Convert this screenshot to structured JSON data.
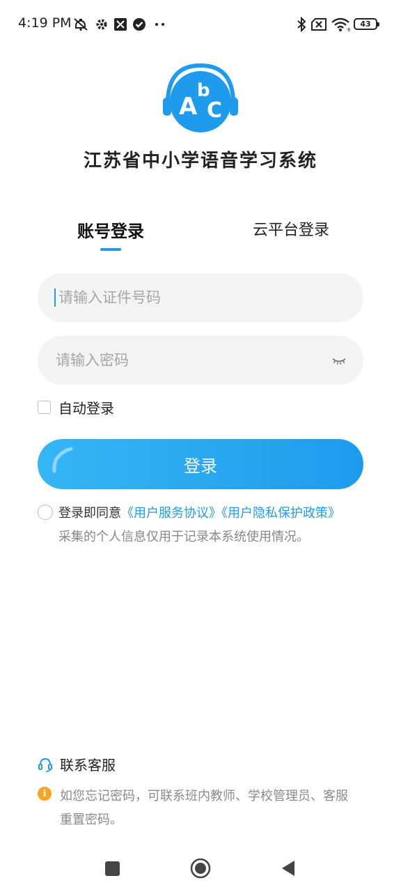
{
  "status_bar": {
    "time": "4:19 PM",
    "icons_left": [
      "mute-icon",
      "gear-icon",
      "app-icon",
      "check-circle-icon",
      "more-dots-icon"
    ],
    "icons_right": [
      "bluetooth-icon",
      "sim-off-icon",
      "wifi-icon"
    ],
    "battery": "43"
  },
  "app": {
    "title": "江苏省中小学语音学习系统",
    "logo_letters": [
      "A",
      "b",
      "C"
    ],
    "accent_color": "#1e9bec"
  },
  "tabs": [
    {
      "label": "账号登录",
      "active": true
    },
    {
      "label": "云平台登录",
      "active": false
    }
  ],
  "form": {
    "id_placeholder": "请输入证件号码",
    "id_value": "",
    "password_placeholder": "请输入密码",
    "password_value": "",
    "auto_login_label": "自动登录",
    "auto_login_checked": false,
    "login_button": "登录"
  },
  "agreement": {
    "prefix": "登录即同意",
    "user_agreement": "《用户服务协议》",
    "privacy_policy": "《用户隐私保护政策》",
    "note": "采集的个人信息仅用于记录本系统使用情况。",
    "agreed": false
  },
  "footer": {
    "contact_label": "联系客服",
    "tip": "如您忘记密码，可联系班内教师、学校管理员、客服重置密码。"
  },
  "nav_bar": [
    "recents-square-icon",
    "home-circle-icon",
    "back-triangle-icon"
  ]
}
